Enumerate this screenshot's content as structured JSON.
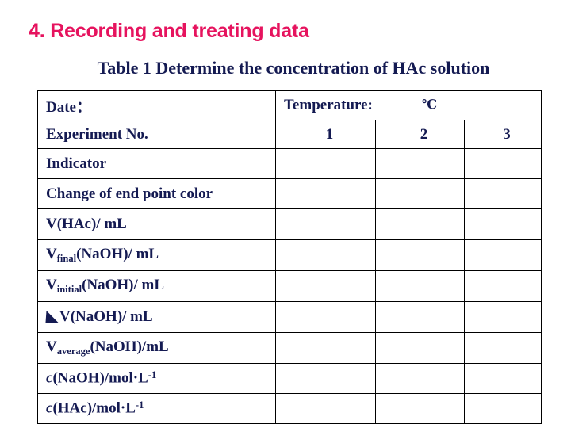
{
  "slide": {
    "heading": "4. Recording and treating data",
    "caption": "Table 1 Determine the concentration of HAc solution",
    "colors": {
      "heading": "#e6135e",
      "text": "#141a52",
      "border": "#000000",
      "background": "#ffffff"
    }
  },
  "table": {
    "header": {
      "date_label": "Date：",
      "temperature_label": "Temperature:",
      "temperature_value": "",
      "temperature_unit": "℃"
    },
    "experiment_row": {
      "label": "Experiment No.",
      "columns": [
        "1",
        "2",
        "3"
      ]
    },
    "rows": [
      {
        "label": "Indicator",
        "values": [
          "",
          "",
          ""
        ]
      },
      {
        "label": "Change of end point color",
        "values": [
          "",
          "",
          ""
        ]
      },
      {
        "label": "V(HAc)/ mL",
        "values": [
          "",
          "",
          ""
        ]
      },
      {
        "label": "Vfinal(NaOH)/ mL",
        "values": [
          "",
          "",
          ""
        ]
      },
      {
        "label": "Vinitial(NaOH)/ mL",
        "values": [
          "",
          "",
          ""
        ]
      },
      {
        "label": "△V(NaOH)/ mL",
        "values": [
          "",
          "",
          ""
        ]
      },
      {
        "label": "Vaverage(NaOH)/mL",
        "values": [
          "",
          "",
          ""
        ]
      },
      {
        "label": "c(NaOH)/mol·L-1",
        "values": [
          "",
          "",
          ""
        ]
      },
      {
        "label": "c(HAc)/mol·L-1",
        "values": [
          "",
          "",
          ""
        ]
      }
    ],
    "row_parts": {
      "v_hac": {
        "main": "V(HAc)/ mL"
      },
      "v_final": {
        "v": "V",
        "sub": "final",
        "rest": "(NaOH)/ mL"
      },
      "v_initial": {
        "v": "V",
        "sub": "initial",
        "rest": "(NaOH)/ mL"
      },
      "v_delta": {
        "rest": "V(NaOH)/ mL"
      },
      "v_average": {
        "v": "V",
        "sub": "average",
        "rest": "(NaOH)/mL"
      },
      "c_naoh": {
        "c": "c",
        "rest": "(NaOH)/mol·L",
        "sup": "-1"
      },
      "c_hac": {
        "c": "c",
        "rest": "(HAc)/mol·L",
        "sup": "-1"
      }
    }
  }
}
